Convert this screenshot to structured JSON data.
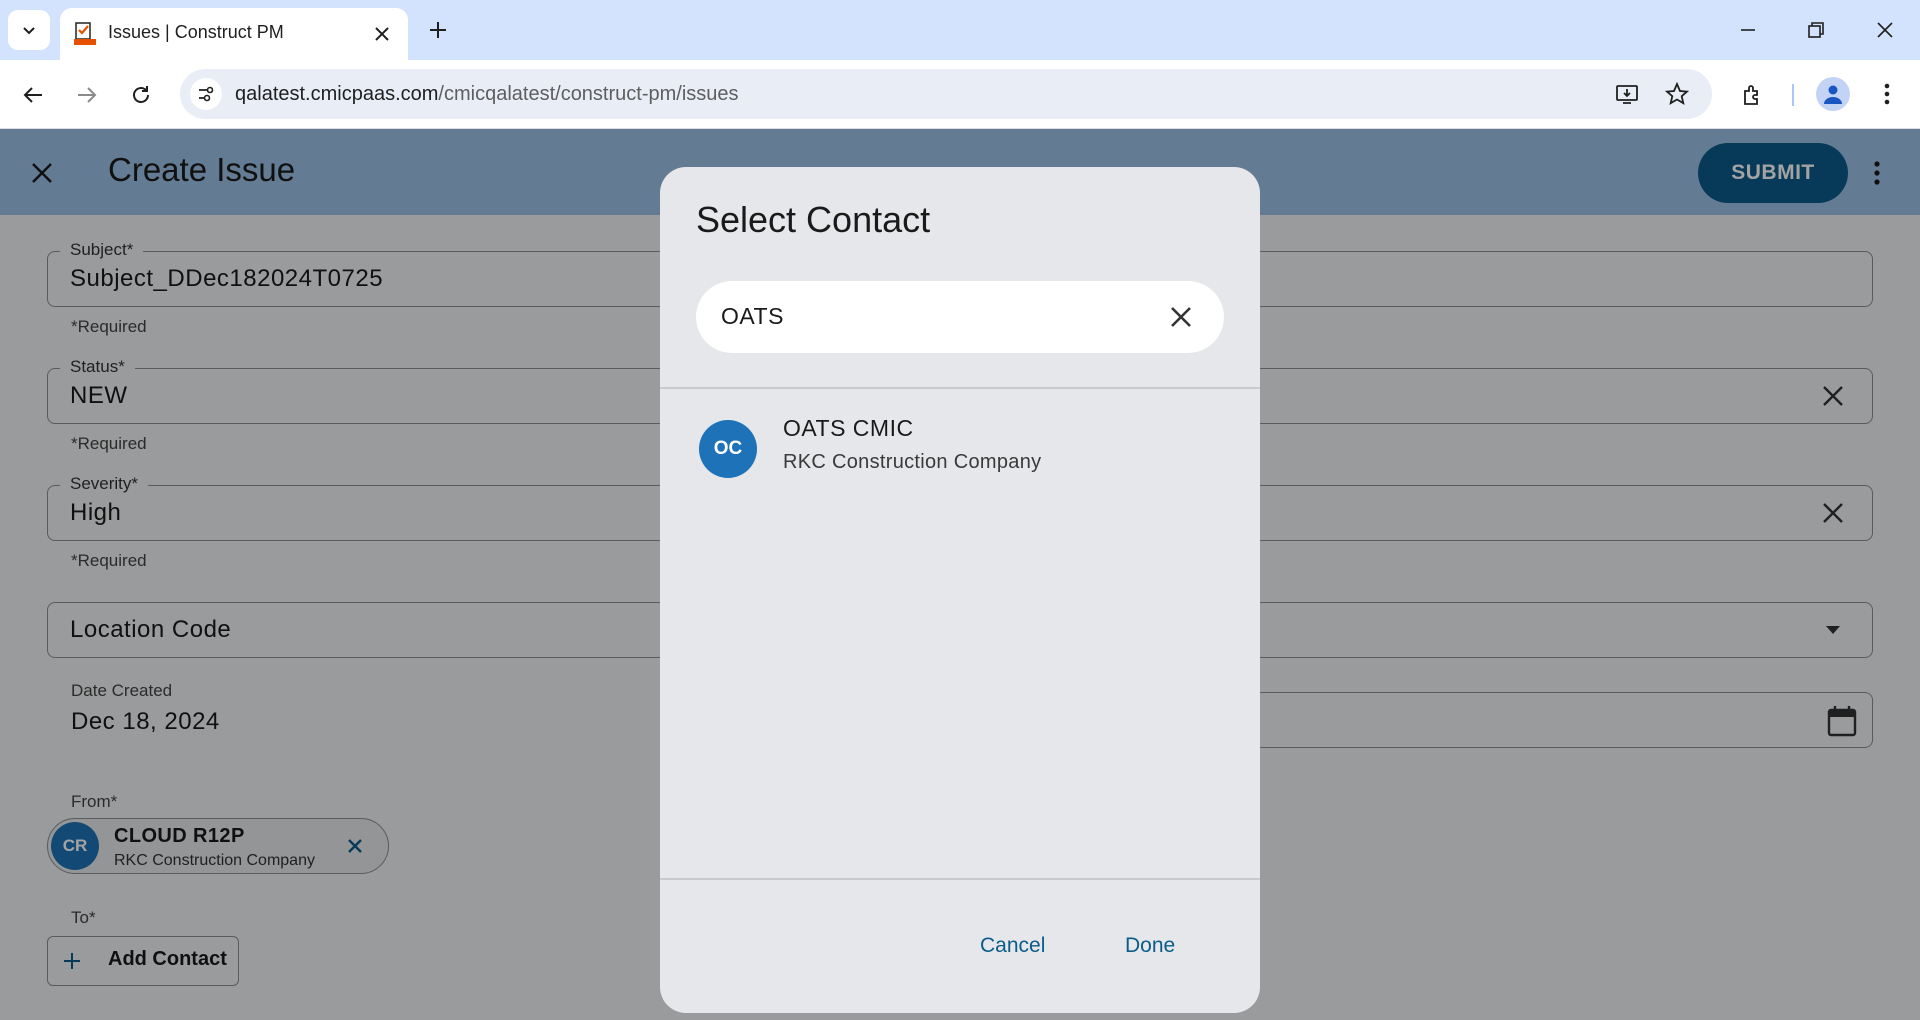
{
  "browser": {
    "tab_title": "Issues | Construct PM",
    "url_host": "qalatest.cmicpaas.com",
    "url_path": "/cmicqalatest/construct-pm/issues"
  },
  "app": {
    "title": "Create Issue",
    "submit_label": "SUBMIT",
    "fields": {
      "subject": {
        "label": "Subject*",
        "value": "Subject_DDec182024T0725",
        "helper": "*Required"
      },
      "status": {
        "label": "Status*",
        "value": "NEW",
        "helper": "*Required"
      },
      "severity": {
        "label": "Severity*",
        "value": "High",
        "helper": "*Required"
      },
      "location": {
        "placeholder": "Location Code"
      },
      "date_created": {
        "label": "Date Created",
        "value": "Dec 18, 2024"
      }
    },
    "from": {
      "label": "From*",
      "contact": {
        "initials": "CR",
        "name": "CLOUD R12P",
        "company": "RKC Construction Company"
      }
    },
    "to": {
      "label": "To*",
      "add_label": "Add Contact"
    }
  },
  "dialog": {
    "title": "Select Contact",
    "search_value": "OATS",
    "results": [
      {
        "initials": "OC",
        "name": "OATS CMIC",
        "company": "RKC Construction Company"
      }
    ],
    "cancel_label": "Cancel",
    "done_label": "Done"
  },
  "colors": {
    "accent": "#0b5c8a",
    "avatar": "#1e73b8",
    "appbar": "#9dc1e8"
  }
}
